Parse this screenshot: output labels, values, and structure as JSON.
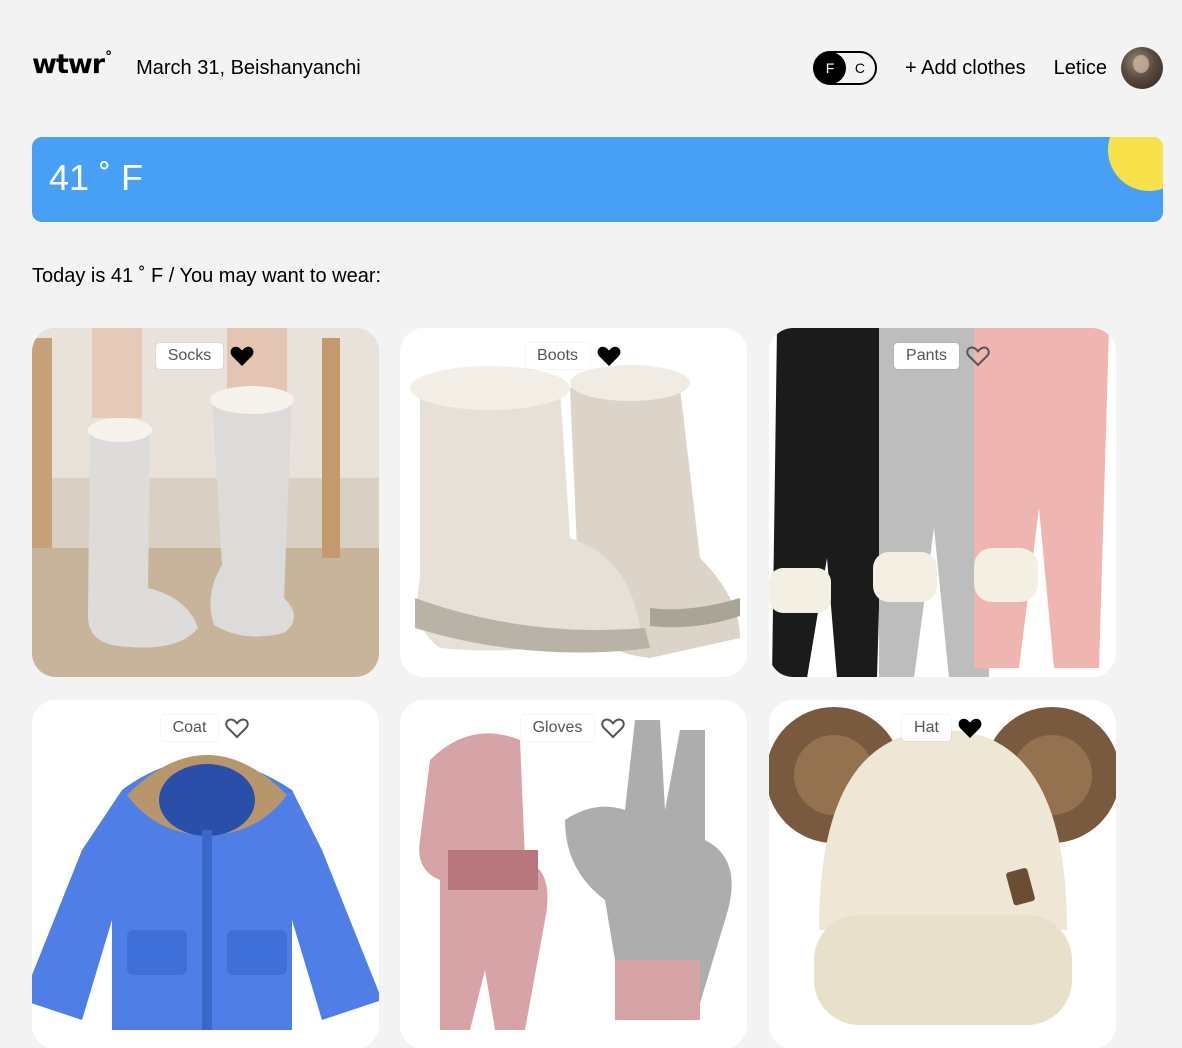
{
  "header": {
    "logo": "wtwr",
    "logo_mark": "°",
    "date_location": "March 31, Beishanyanchi",
    "unit_toggle": {
      "f_label": "F",
      "c_label": "C",
      "selected": "F"
    },
    "add_clothes_label": "+ Add clothes",
    "username": "Letice"
  },
  "weather": {
    "temperature": "41 ˚ F",
    "condition_icon": "sun-icon",
    "colors": {
      "background": "#47a0f5",
      "sun": "#f8e24b"
    }
  },
  "recommendation_text": "Today is 41 ˚ F / You may want to wear:",
  "items": [
    {
      "name": "Socks",
      "liked": true
    },
    {
      "name": "Boots",
      "liked": true
    },
    {
      "name": "Pants",
      "liked": false
    },
    {
      "name": "Coat",
      "liked": false
    },
    {
      "name": "Gloves",
      "liked": false
    },
    {
      "name": "Hat",
      "liked": true
    }
  ]
}
